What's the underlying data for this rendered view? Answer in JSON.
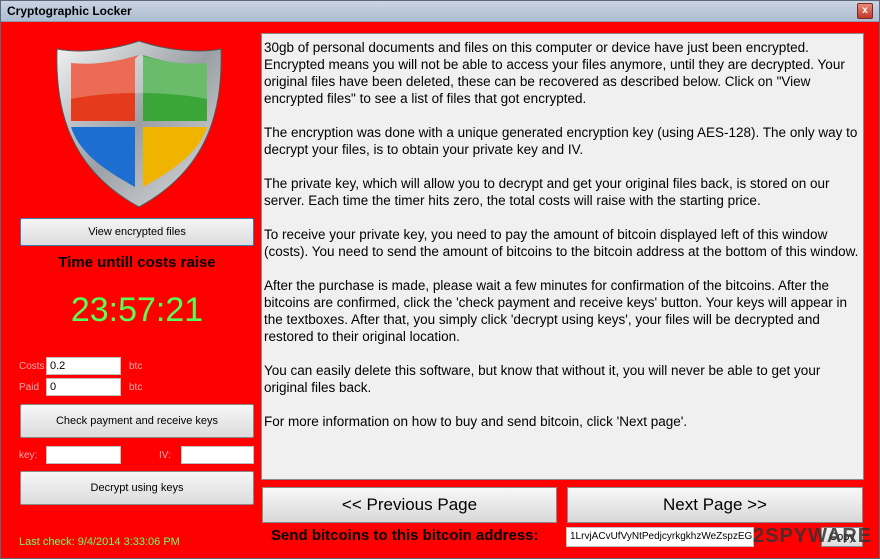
{
  "window": {
    "title": "Cryptographic Locker",
    "close_label": "x"
  },
  "left": {
    "view_button": "View encrypted files",
    "time_label": "Time untill costs raise",
    "timer": "23:57:21",
    "costs_label": "Costs",
    "costs_value": "0.2",
    "costs_unit": "btc",
    "paid_label": "Paid",
    "paid_value": "0",
    "paid_unit": "btc",
    "check_button": "Check payment and receive keys",
    "key_label": "key:",
    "iv_label": "IV:",
    "decrypt_button": "Decrypt using keys",
    "last_check": "Last check: 9/4/2014 3:33:06 PM"
  },
  "message": {
    "paragraphs": [
      "30gb of personal documents and files on this computer or device have just been encrypted. Encrypted means you will not be able to access your files anymore, until they are decrypted. Your original files have been deleted, these can be recovered as described below. Click on \"View encrypted files\" to see a list of files that got encrypted.",
      "The encryption was done with a unique generated encryption key (using AES-128). The only way to decrypt your files, is to obtain your private key and IV.",
      "The private key, which will allow you to decrypt and get your original files back, is stored on our server. Each time the timer hits zero, the total costs will raise with the starting price.",
      "To receive your private key, you need to pay the amount of bitcoin displayed left of this window (costs). You need to send the amount of bitcoins to the bitcoin address at the bottom of this window.",
      "After the purchase is made, please wait a few minutes for confirmation of the bitcoins. After the bitcoins are confirmed, click the 'check payment and receive keys' button. Your keys will appear in the textboxes. After that, you simply click 'decrypt using keys', your files will be decrypted and restored to their original location.",
      "You can easily delete this software, but know that without it, you will never be able to get your original files back.",
      "For more information on how to buy and send bitcoin, click 'Next page'."
    ]
  },
  "nav": {
    "prev": "<< Previous Page",
    "next": "Next Page >>"
  },
  "footer": {
    "send_label": "Send bitcoins to this bitcoin address:",
    "address": "1LrvjACvUfVyNtPedjcyrkgkhzWeZspzEG",
    "copy_label": "Copy",
    "watermark": "2SPYWARE"
  }
}
